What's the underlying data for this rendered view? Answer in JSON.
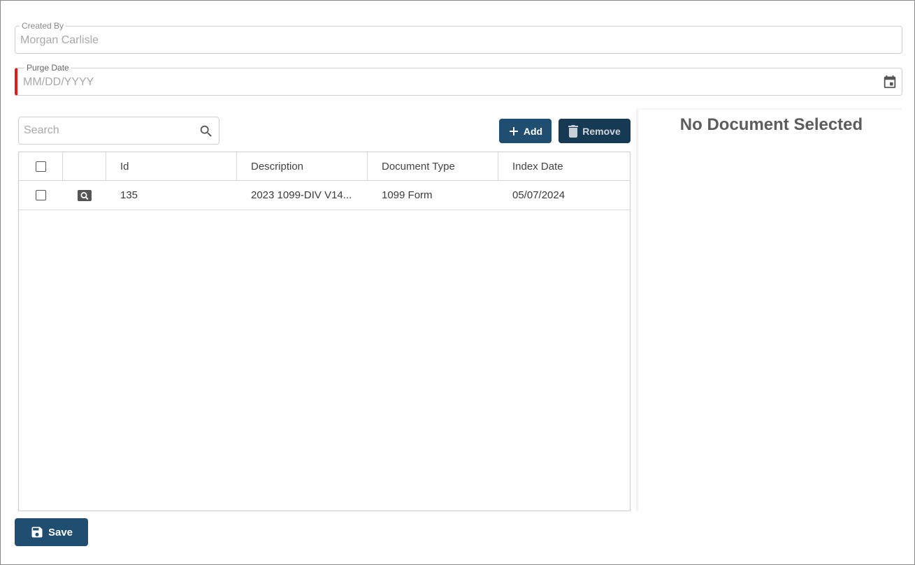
{
  "form": {
    "created_by": {
      "label": "Created By",
      "value": "Morgan Carlisle"
    },
    "purge_date": {
      "label": "Purge Date",
      "placeholder": "MM/DD/YYYY"
    }
  },
  "documents": {
    "search_placeholder": "Search",
    "add_label": "Add",
    "remove_label": "Remove",
    "columns": [
      "Id",
      "Description",
      "Document Type",
      "Index Date"
    ],
    "rows": [
      {
        "id": "135",
        "description": "2023 1099-DIV V14...",
        "type": "1099 Form",
        "index_date": "05/07/2024"
      }
    ]
  },
  "preview": {
    "empty_title": "No Document Selected"
  },
  "footer": {
    "save_label": "Save"
  },
  "colors": {
    "primary": "#1f4e70",
    "primary_dark": "#173a54",
    "required": "#e01b1b"
  },
  "icons": {
    "calendar": "calendar-icon",
    "search": "search-icon",
    "add": "plus-icon",
    "remove": "trash-icon",
    "view": "view-document-icon",
    "save": "floppy-disk-icon"
  }
}
